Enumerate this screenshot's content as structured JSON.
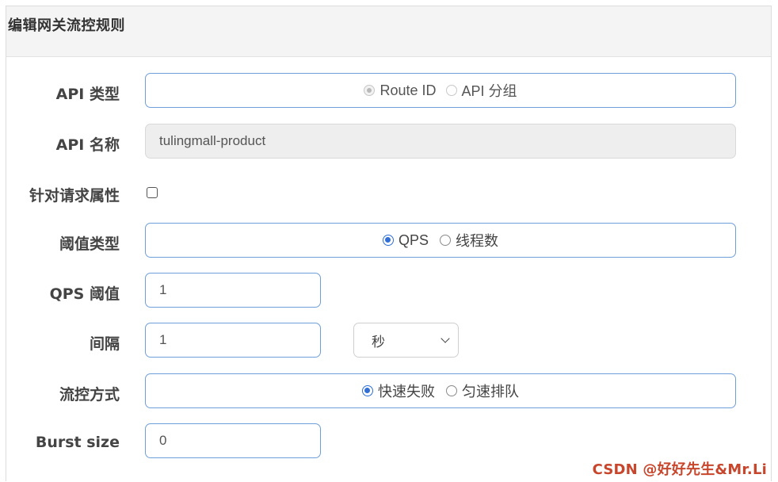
{
  "dialog": {
    "title": "编辑网关流控规则"
  },
  "form": {
    "api_type": {
      "label": "API 类型",
      "options": [
        {
          "label": "Route ID",
          "state": "checked-disabled"
        },
        {
          "label": "API 分组",
          "state": "unchecked-disabled"
        }
      ]
    },
    "api_name": {
      "label": "API 名称",
      "value": "tulingmall-product"
    },
    "request_attr": {
      "label": "针对请求属性",
      "checked": false
    },
    "threshold_type": {
      "label": "阈值类型",
      "options": [
        {
          "label": "QPS",
          "state": "checked"
        },
        {
          "label": "线程数",
          "state": "unchecked"
        }
      ]
    },
    "qps_threshold": {
      "label": "QPS 阈值",
      "value": "1"
    },
    "interval": {
      "label": "间隔",
      "value": "1",
      "unit": "秒"
    },
    "control_mode": {
      "label": "流控方式",
      "options": [
        {
          "label": "快速失败",
          "state": "checked"
        },
        {
          "label": "匀速排队",
          "state": "unchecked"
        }
      ]
    },
    "burst_size": {
      "label": "Burst size",
      "value": "0"
    }
  },
  "watermark": "CSDN @好好先生&Mr.Li",
  "colors": {
    "accent": "#2f6fd6",
    "border": "#6f9fd8",
    "watermark": "#c8462c"
  }
}
